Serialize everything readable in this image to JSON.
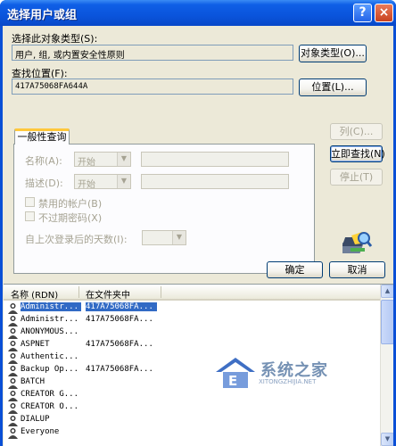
{
  "window": {
    "title": "选择用户或组",
    "help_glyph": "?",
    "close_glyph": "×"
  },
  "object_type": {
    "label": "选择此对象类型(S):",
    "value": "用户, 组, 或内置安全性原则",
    "button": "对象类型(O)..."
  },
  "location": {
    "label": "查找位置(F):",
    "value": "417A75068FA644A",
    "button": "位置(L)..."
  },
  "query_tab": {
    "tab_label": "一般性查询",
    "name_label": "名称(A):",
    "name_combo": "开始",
    "desc_label": "描述(D):",
    "desc_combo": "开始",
    "disabled_accounts": "禁用的帐户(B)",
    "no_expire_pwd": "不过期密码(X)",
    "days_since_login": "自上次登录后的天数(I):"
  },
  "side_buttons": {
    "columns": "列(C)...",
    "find_now": "立即查找(N)",
    "stop": "停止(T)"
  },
  "dialog_buttons": {
    "ok": "确定",
    "cancel": "取消"
  },
  "results": {
    "columns": [
      "名称 (RDN)",
      "在文件夹中"
    ],
    "rows": [
      {
        "name": "Administr...",
        "folder": "417A75068FA...",
        "selected": true
      },
      {
        "name": "Administr...",
        "folder": "417A75068FA..."
      },
      {
        "name": "ANONYMOUS...",
        "folder": ""
      },
      {
        "name": "ASPNET",
        "folder": "417A75068FA..."
      },
      {
        "name": "Authentic...",
        "folder": ""
      },
      {
        "name": "Backup Op...",
        "folder": "417A75068FA..."
      },
      {
        "name": "BATCH",
        "folder": ""
      },
      {
        "name": "CREATOR G...",
        "folder": ""
      },
      {
        "name": "CREATOR O...",
        "folder": ""
      },
      {
        "name": "DIALUP",
        "folder": ""
      },
      {
        "name": "Everyone",
        "folder": ""
      }
    ]
  },
  "watermark": {
    "text": "系统之家",
    "url": "XITONGZHIJIA.NET"
  },
  "colors": {
    "titlebar": "#0a54dc",
    "dialog_bg": "#ece9d8",
    "selection": "#316ac5",
    "tab_accent": "#ffc83c"
  }
}
